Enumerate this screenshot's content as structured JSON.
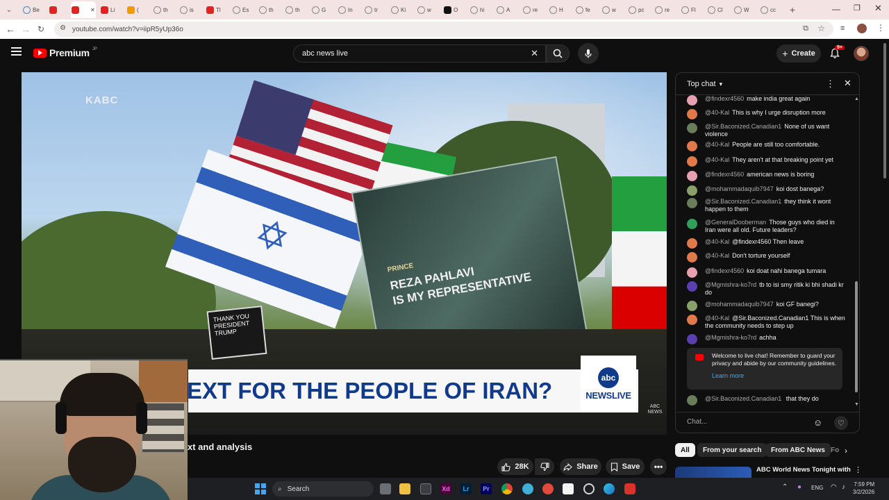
{
  "browser": {
    "tabs": [
      {
        "label": "Be",
        "color": "#4a86c5"
      },
      {
        "label": "",
        "color": "#e02424"
      },
      {
        "label": "",
        "color": "#e02424",
        "active": true
      },
      {
        "label": "Li",
        "color": "#e02424"
      },
      {
        "label": "(",
        "color": "#f29900"
      },
      {
        "label": "th",
        "color": "#888888"
      },
      {
        "label": "is",
        "color": "#888888"
      },
      {
        "label": "Tl",
        "color": "#e02424"
      },
      {
        "label": "Es",
        "color": "#888888"
      },
      {
        "label": "th",
        "color": "#888888"
      },
      {
        "label": "th",
        "color": "#888888"
      },
      {
        "label": "G",
        "color": "#888888"
      },
      {
        "label": "In",
        "color": "#888888"
      },
      {
        "label": "tr",
        "color": "#888888"
      },
      {
        "label": "Ki",
        "color": "#888888"
      },
      {
        "label": "w",
        "color": "#888888"
      },
      {
        "label": "O",
        "color": "#111111"
      },
      {
        "label": "hi",
        "color": "#888888"
      },
      {
        "label": "A",
        "color": "#888888"
      },
      {
        "label": "re",
        "color": "#888888"
      },
      {
        "label": "H",
        "color": "#888888"
      },
      {
        "label": "fe",
        "color": "#888888"
      },
      {
        "label": "w",
        "color": "#888888"
      },
      {
        "label": "pc",
        "color": "#888888"
      },
      {
        "label": "re",
        "color": "#888888"
      },
      {
        "label": "Fl",
        "color": "#888888"
      },
      {
        "label": "Cl",
        "color": "#888888"
      },
      {
        "label": "W",
        "color": "#888888"
      },
      {
        "label": "cc",
        "color": "#888888"
      }
    ],
    "url": "youtube.com/watch?v=iipR5yUp36o"
  },
  "header": {
    "brand": "Premium",
    "region": "JP",
    "search_value": "abc news live",
    "create_label": "Create",
    "notif_count": "9+"
  },
  "video": {
    "station_tag": "KABC",
    "lower_third": "EXT FOR THE PEOPLE OF IRAN?",
    "abc_logo": "abc",
    "abc_news": "NEWS",
    "abc_live": "LIVE",
    "bug_text": "ABC NEWS",
    "poster_small": "PRINCE",
    "poster_line1": "REZA PAHLAVI",
    "poster_line2": "IS MY REPRESENTATIVE",
    "sign_text": "THANK YOU PRESIDENT TRUMP",
    "title_fragment": "xt and analysis"
  },
  "actions": {
    "likes": "28K",
    "share": "Share",
    "save": "Save"
  },
  "chat": {
    "title": "Top chat",
    "messages": [
      {
        "author": "@findexr4560",
        "text": "make india great again",
        "color": "#e8a0b0"
      },
      {
        "author": "@40-Kal",
        "text": "This is why I urge disruption more",
        "color": "#e07a4a"
      },
      {
        "author": "@Sir.Baconized.Canadian1",
        "text": "None of us want violence",
        "color": "#6a7d5a"
      },
      {
        "author": "@40-Kal",
        "text": "People are still too comfortable.",
        "color": "#e07a4a"
      },
      {
        "author": "@40-Kal",
        "text": "They aren't at that breaking point yet",
        "color": "#e07a4a"
      },
      {
        "author": "@findexr4560",
        "text": "american news is boring",
        "color": "#e8a0b0"
      },
      {
        "author": "@mohammadaquib7947",
        "text": "koi dost banega?",
        "color": "#8aa06a"
      },
      {
        "author": "@Sir.Baconized.Canadian1",
        "text": "they think it wont happen to them",
        "color": "#6a7d5a"
      },
      {
        "author": "@GeneralDooberman",
        "text": "Those guys who died in Iran were all old. Future leaders?",
        "color": "#2fa05a"
      },
      {
        "author": "@40-Kal",
        "text": "@findexr4560 Then leave",
        "color": "#e07a4a"
      },
      {
        "author": "@40-Kal",
        "text": "Don't torture yourself",
        "color": "#e07a4a"
      },
      {
        "author": "@findexr4560",
        "text": "koi doat nahi banega tumara",
        "color": "#e8a0b0"
      },
      {
        "author": "@Mgmishra-ko7rd",
        "text": "tb to isi smy ritik ki bhi shadi kr do",
        "color": "#5b3fb0"
      },
      {
        "author": "@mohammadaquib7947",
        "text": "koi GF banegi?",
        "color": "#8aa06a"
      },
      {
        "author": "@40-Kal",
        "text": "@Sir.Baconized.Canadian1 This is when the community needs to step up",
        "color": "#e07a4a"
      },
      {
        "author": "@Mgmishra-ko7rd",
        "text": "achha",
        "color": "#5b3fb0"
      }
    ],
    "welcome": "Welcome to live chat! Remember to guard your privacy and abide by our community guidelines.",
    "learn_more": "Learn more",
    "last_message": {
      "author": "@Sir.Baconized.Canadian1",
      "text": "that they do",
      "color": "#6a7d5a"
    },
    "input_placeholder": "Chat..."
  },
  "chips": [
    "All",
    "From your search",
    "From ABC News",
    "Fo"
  ],
  "recommended": {
    "title": "ABC World News Tonight with"
  },
  "taskbar": {
    "search": "Search",
    "lang": "ENG",
    "time": "7:59 PM",
    "date": "3/2/2026"
  }
}
